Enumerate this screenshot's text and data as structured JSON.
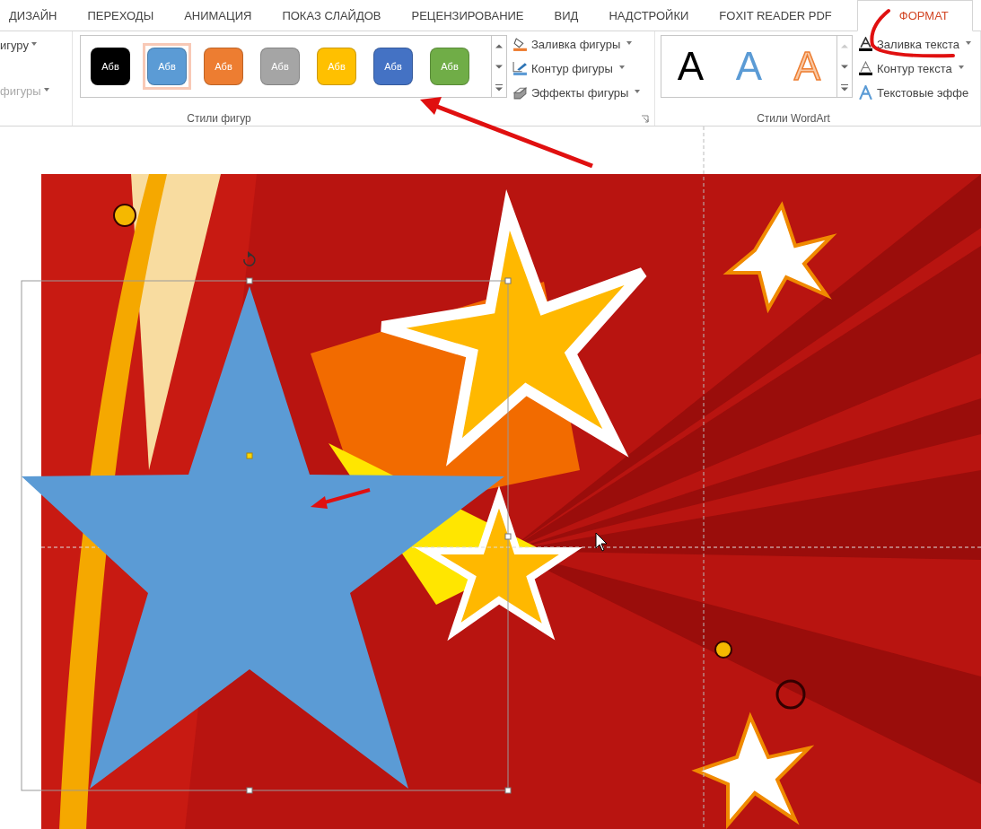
{
  "tabs": [
    {
      "label": "ДИЗАЙН",
      "selected": false
    },
    {
      "label": "ПЕРЕХОДЫ",
      "selected": false
    },
    {
      "label": "АНИМАЦИЯ",
      "selected": false
    },
    {
      "label": "ПОКАЗ СЛАЙДОВ",
      "selected": false
    },
    {
      "label": "РЕЦЕНЗИРОВАНИЕ",
      "selected": false
    },
    {
      "label": "ВИД",
      "selected": false
    },
    {
      "label": "НАДСТРОЙКИ",
      "selected": false
    },
    {
      "label": "FOXIT READER PDF",
      "selected": false
    },
    {
      "label": "ФОРМАТ",
      "selected": true
    }
  ],
  "ribbon": {
    "left_group": [
      {
        "label": "игуру",
        "disabled": false
      },
      {
        "label": "фигуры",
        "disabled": true
      }
    ],
    "shape_styles": {
      "swatches": [
        {
          "label": "Абв",
          "color": "#000000",
          "selected": false
        },
        {
          "label": "Абв",
          "color": "#5b9bd5",
          "selected": true
        },
        {
          "label": "Абв",
          "color": "#ed7d31",
          "selected": false
        },
        {
          "label": "Абв",
          "color": "#a5a5a5",
          "selected": false
        },
        {
          "label": "Абв",
          "color": "#ffc000",
          "selected": false
        },
        {
          "label": "Абв",
          "color": "#4472c4",
          "selected": false
        },
        {
          "label": "Абв",
          "color": "#70ad47",
          "selected": false
        }
      ],
      "commands": [
        {
          "label": "Заливка фигуры",
          "kind": "fill"
        },
        {
          "label": "Контур фигуры",
          "kind": "outline"
        },
        {
          "label": "Эффекты фигуры",
          "kind": "effects"
        }
      ],
      "group_label": "Стили фигур"
    },
    "wordart": {
      "samples": [
        {
          "letter": "A",
          "kind": "plain"
        },
        {
          "letter": "A",
          "kind": "blue"
        },
        {
          "letter": "A",
          "kind": "outline"
        }
      ],
      "commands": [
        {
          "label": "Заливка текста",
          "kind": "fill"
        },
        {
          "label": "Контур текста",
          "kind": "outline"
        },
        {
          "label": "Текстовые эффе",
          "kind": "effects"
        }
      ],
      "group_label": "Стили WordArt"
    }
  }
}
